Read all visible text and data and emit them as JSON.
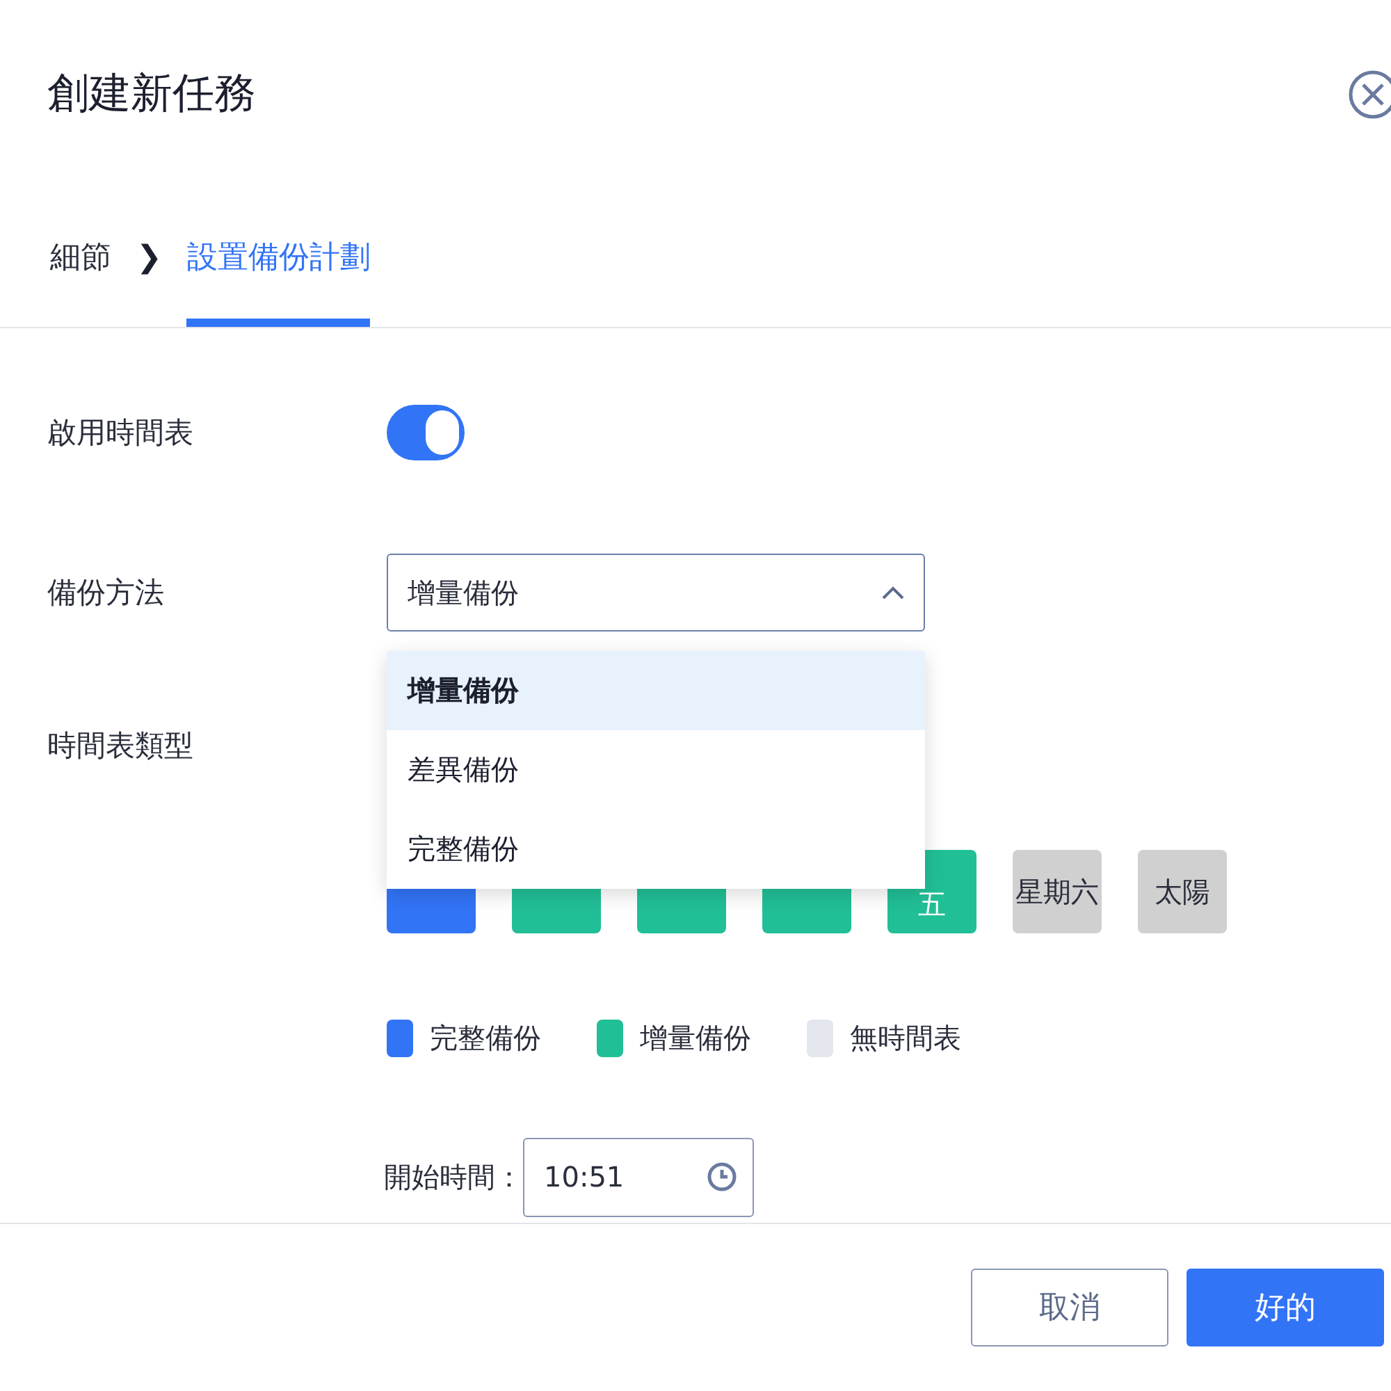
{
  "dialog": {
    "title": "創建新任務"
  },
  "steps": [
    {
      "label": "細節",
      "selected": false
    },
    {
      "label": "設置備份計劃",
      "selected": true
    }
  ],
  "step_separator": "❯",
  "schedule_toggle": {
    "label": "啟用時間表",
    "on": true
  },
  "backup_method": {
    "label": "備份方法",
    "value": "增量備份",
    "expanded": true,
    "options": [
      {
        "label": "增量備份",
        "selected": true
      },
      {
        "label": "差異備份",
        "selected": false
      },
      {
        "label": "完整備份",
        "selected": false
      }
    ]
  },
  "schedule_type": {
    "label": "時間表類型"
  },
  "days": [
    {
      "kind": "full"
    },
    {
      "kind": "incremental"
    },
    {
      "kind": "incremental"
    },
    {
      "kind": "incremental"
    },
    {
      "label": "五",
      "kind": "incremental"
    },
    {
      "label": "星期六",
      "kind": "none"
    },
    {
      "label": "太陽",
      "kind": "none"
    }
  ],
  "legend": [
    {
      "label": "完整備份",
      "color": "#3274f6"
    },
    {
      "label": "增量備份",
      "color": "#21bf96"
    },
    {
      "label": "無時間表",
      "color": "#e3e6ec"
    }
  ],
  "start_time": {
    "label": "開始時間：",
    "value": "10:51"
  },
  "buttons": [
    {
      "label": "取消",
      "kind": "secondary"
    },
    {
      "label": "好的",
      "kind": "primary"
    }
  ]
}
